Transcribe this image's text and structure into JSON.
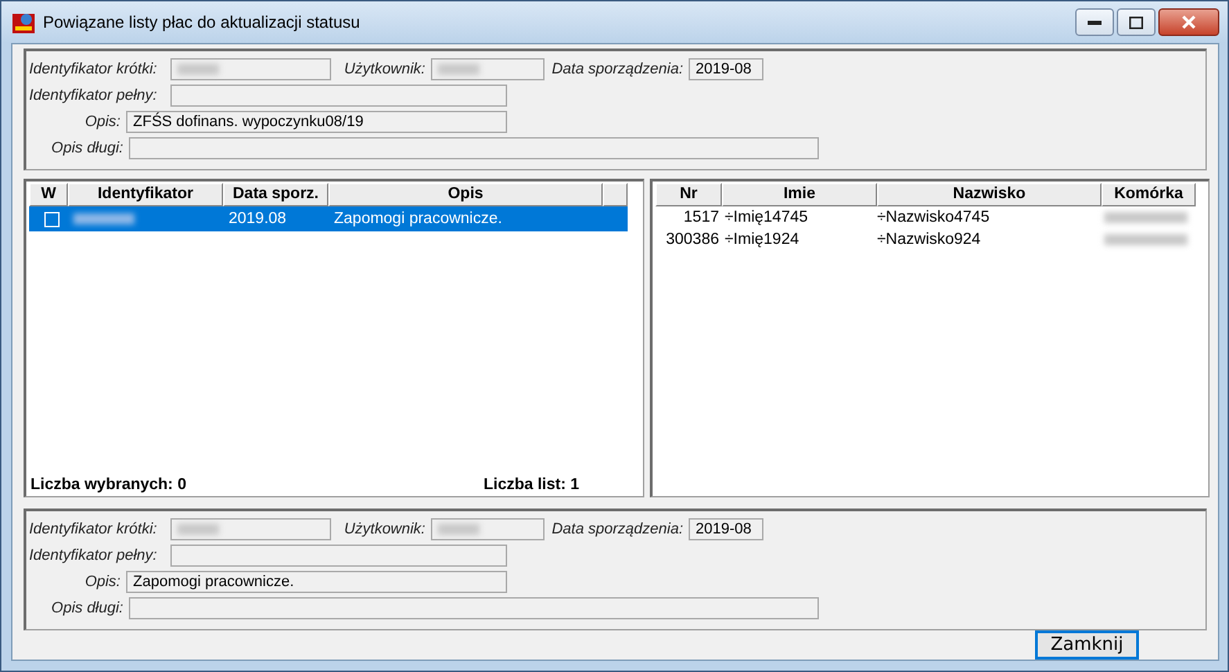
{
  "window": {
    "title": "Powiązane listy płac do aktualizacji statusu"
  },
  "header_panel": {
    "fields": [
      {
        "label": "Identyfikator krótki:",
        "redacted": true
      },
      {
        "label": "Użytkownik:",
        "redacted": true
      },
      {
        "label": "Data sporządzenia:",
        "value": "2019-08"
      },
      {
        "label": "Identyfikator pełny:"
      },
      {
        "label": "Opis:",
        "value": "ZFŚS dofinans. wypoczynku08/19"
      },
      {
        "label": "Opis długi:"
      }
    ]
  },
  "lists_table": {
    "columns": [
      "W",
      "Identyfikator",
      "Data sporz.",
      "Opis"
    ],
    "rows": [
      {
        "checked": false,
        "selected": true,
        "identyfikator_redacted": true,
        "data": "2019.08",
        "opis": "Zapomogi pracownicze."
      }
    ],
    "selected_count": "Liczba wybranych: 0",
    "list_count": "Liczba list: 1"
  },
  "people_table": {
    "columns": [
      "Nr",
      "Imie",
      "Nazwisko",
      "Komórka"
    ],
    "rows": [
      {
        "nr": "1517",
        "imie": "÷Imię14745",
        "nazwisko": "÷Nazwisko4745",
        "komorka_redacted": true
      },
      {
        "nr": "300386",
        "imie": "÷Imię1924",
        "nazwisko": "÷Nazwisko924",
        "komorka_redacted": true
      }
    ]
  },
  "footer_panel": {
    "fields": [
      {
        "label": "Identyfikator krótki:",
        "redacted": true
      },
      {
        "label": "Użytkownik:",
        "redacted": true
      },
      {
        "label": "Data sporządzenia:",
        "value": "2019-08"
      },
      {
        "label": "Identyfikator pełny:"
      },
      {
        "label": "Opis:",
        "value": "Zapomogi pracownicze."
      },
      {
        "label": "Opis długi:"
      }
    ]
  },
  "buttons": [
    "Zamknij"
  ]
}
